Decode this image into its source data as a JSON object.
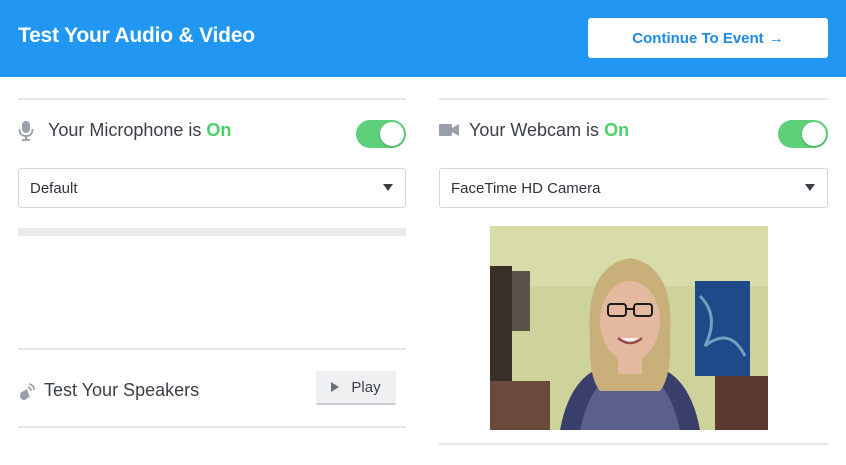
{
  "header": {
    "title": "Test Your Audio & Video",
    "continue_label": "Continue To Event",
    "continue_arrow": "→",
    "background_color": "#2196f3"
  },
  "microphone": {
    "label": "Your Microphone is",
    "status": "On",
    "icon": "microphone-icon",
    "toggle_on": true,
    "selected_device": "Default",
    "input_level": 0
  },
  "webcam": {
    "label": "Your Webcam is",
    "status": "On",
    "icon": "video-camera-icon",
    "toggle_on": true,
    "selected_device": "FaceTime HD Camera"
  },
  "speakers": {
    "label": "Test Your Speakers",
    "icon": "speaker-icon",
    "play_label": "Play"
  },
  "colors": {
    "accent": "#2196f3",
    "on_green": "#4cd06a",
    "toggle_green": "#5fd07a"
  }
}
